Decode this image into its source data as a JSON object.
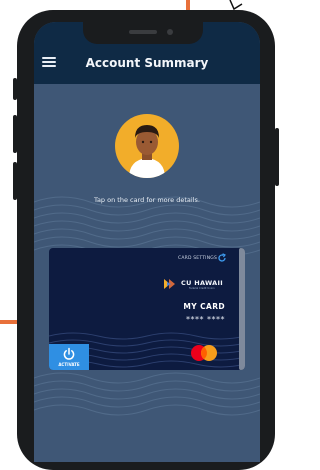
{
  "header": {
    "title": "Account Summary"
  },
  "profile": {
    "hint": "Tap on the card for more details."
  },
  "card": {
    "settings_label": "CARD SETTINGS",
    "brand_name": "CU HAWAII",
    "brand_tagline": "Federal Credit Union",
    "card_name": "MY CARD",
    "masked_number": "**** ****",
    "activate_label": "ACTIVATE",
    "network": "mastercard-logo"
  },
  "colors": {
    "header_bg": "#0f2a45",
    "screen_bg": "#3f5776",
    "card_bg": "#0d1b40",
    "activate_bg": "#2f8fe3",
    "avatar_bg": "#f2ad2a",
    "accent_orange": "#e8703a"
  }
}
